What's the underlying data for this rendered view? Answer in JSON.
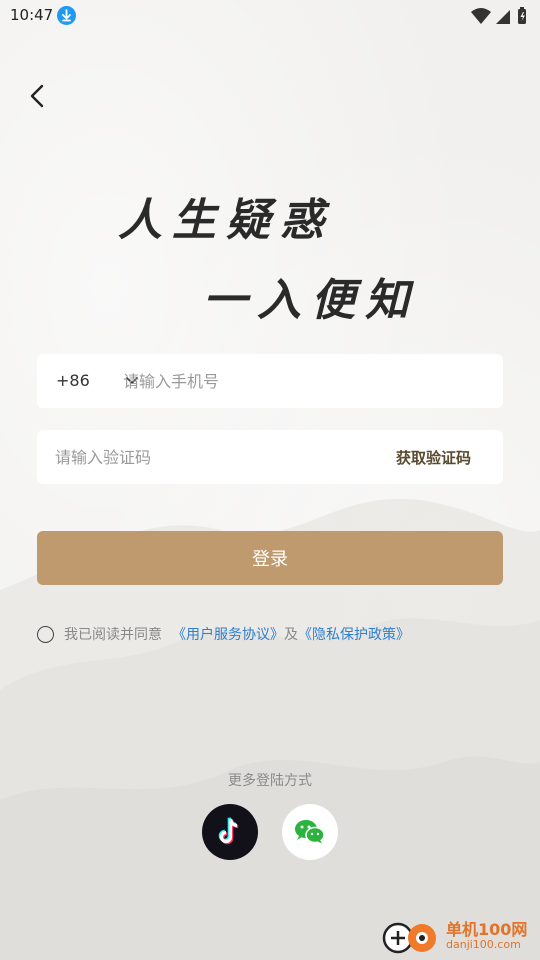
{
  "status_bar": {
    "time": "10:47",
    "download_icon": "download-icon",
    "icons": [
      "wifi-icon",
      "signal-icon",
      "battery-icon"
    ]
  },
  "header": {
    "back_icon": "chevron-left-icon"
  },
  "slogan": {
    "line1": "人生疑惑",
    "line2": "一入便知"
  },
  "phone_field": {
    "country_code": "+86",
    "placeholder": "请输入手机号",
    "value": ""
  },
  "code_field": {
    "placeholder": "请输入验证码",
    "value": "",
    "get_code_label": "获取验证码"
  },
  "login_button": {
    "label": "登录"
  },
  "agreement": {
    "checked": false,
    "prefix": "我已阅读并同意",
    "user_agreement": "《用户服务协议》",
    "and": "及",
    "privacy_policy": "《隐私保护政策》"
  },
  "more_login": {
    "label": "更多登陆方式",
    "options": [
      "tiktok-icon",
      "wechat-icon"
    ]
  },
  "watermark": {
    "text": "单机100网",
    "url": "danji100.com"
  },
  "colors": {
    "login_button": "#bf9a6f",
    "link": "#2f7fd0",
    "get_code": "#5a4a2f",
    "watermark": "#e2732a"
  }
}
